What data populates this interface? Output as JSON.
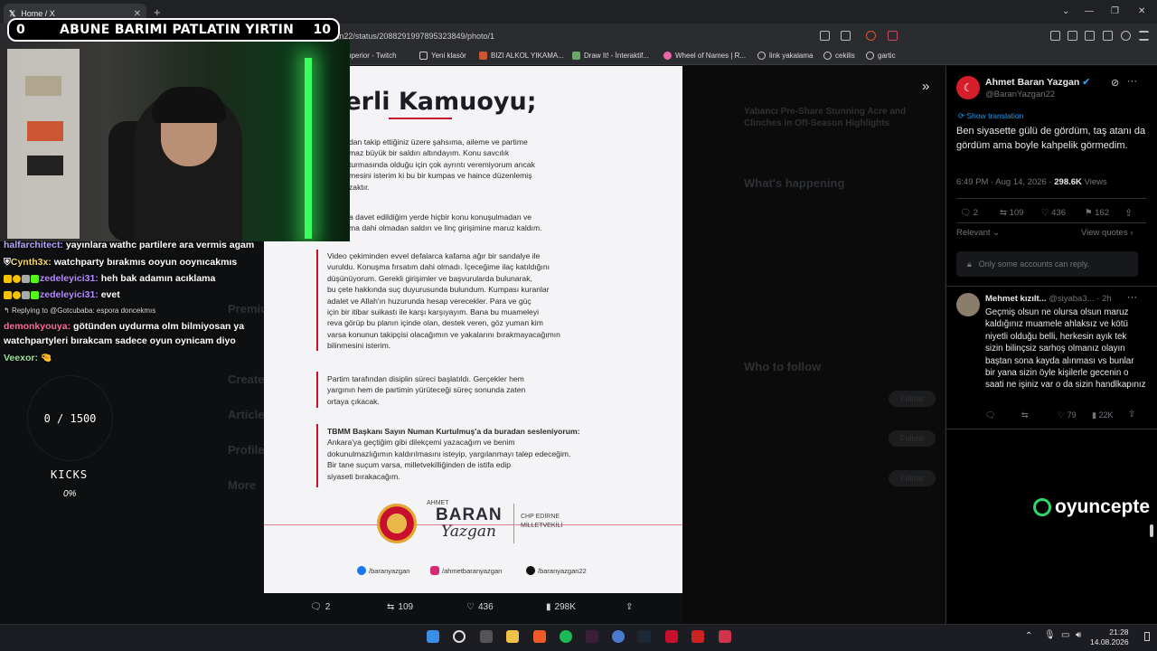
{
  "browser": {
    "tab_title": "Home / X",
    "new_tab": "+",
    "url": "x.com/BaranYazgan22/status/2088291997895323849/photo/1",
    "bookmarks": [
      "superior - Twitch",
      "Yeni klasör",
      "BIZI ALKOL YIKAMA...",
      "Draw It! - İnteraktif...",
      "Wheel of Names | R...",
      "link yakalama",
      "cekilis",
      "gartic"
    ]
  },
  "stream": {
    "left_score": "0",
    "title": "ABUNE BARIMI PATLATIN YIRTIN",
    "right_score": "10",
    "goal": "0 / 1500",
    "kicks_label": "KICKS",
    "kicks_pct": "0%",
    "sponsor": "oyuncepte",
    "chat": [
      {
        "user": "halfarchitect:",
        "text": " yayınlara wathc partilere ara vermis agam"
      },
      {
        "user": "Cynth3x:",
        "text": " watchparty bırakmıs ooyun ooynıcakmıs"
      },
      {
        "user": "zedeleyici31:",
        "text": " heh bak adamın acıklama"
      },
      {
        "user": "zedeleyici31:",
        "text": " evet"
      },
      {
        "reply": "Replying to @Gotcubaba: espora doncekmıs"
      },
      {
        "user": "demonkyouya:",
        "text": " götünden uydurma olm bilmiyosan ya"
      },
      {
        "cont": "watchpartyleri bırakcam sadece oyun oynicam diyo"
      },
      {
        "user": "Veexor:",
        "text": " 🤏"
      }
    ]
  },
  "photo": {
    "headline": "ğerli Kamuoyu;",
    "p1": [
      "dan takip ettiğiniz üzere şahsıma, aileme ve partime",
      "maz büyük bir saldırı altındayım. Konu savcılık",
      "turmasında olduğu için çok ayrıntı veremiyorum ancak",
      "mesini isterim ki bu bir kumpas ve haince düzenlemiş",
      "zaktır."
    ],
    "p2": [
      "a davet edildiğim yerde hiçbir konu konuşulmadan ve",
      "ma dahi olmadan saldırı ve linç girişimine maruz kaldım."
    ],
    "p3": [
      "Video çekiminden evvel defalarca kafama ağır bir sandalye ile",
      "vuruldu. Konuşma fırsatım dahi olmadı. İçeceğime ilaç katıldığını",
      "düşünüyorum. Gerekli girişimler ve başvurularda bulunarak,",
      "bu çete hakkında suç duyurusunda bulundum. Kumpası kuranlar",
      "adalet ve Allah'ın huzurunda hesap verecekler. Para ve güç",
      "için bir itibar suikastı ile karşı karşıyayım. Bana bu muameleyi",
      "reva görüp bu planın içinde olan, destek veren, göz yuman kim",
      "varsa konunun takipçisi olacağımın ve yakalarını bırakmayacağımın",
      "bilinmesini isterim."
    ],
    "p4": [
      "Partim tarafından disiplin süreci başlatıldı. Gerçekler hem",
      "yargının hem de partimin yürüteceği süreç sonunda zaten",
      "ortaya çıkacak."
    ],
    "p5_title": "TBMM Başkanı Sayın Numan Kurtulmuş'a da buradan sesleniyorum:",
    "p5": [
      "Ankara'ya geçtiğim gibi dilekçemi yazacağım ve benim",
      "dokunulmazlığımın kaldırılmasını isteyip, yargılanmayı talep edeceğim.",
      "Bir tane suçum varsa, milletvekilliğinden de istifa edip",
      "siyaseti bırakacağım."
    ],
    "sig_small": "AHMET",
    "sig_big": "BARAN",
    "sig_script": "Yazgan",
    "org": [
      "CHP EDİRNE",
      "MİLLETVEKİLİ"
    ],
    "social": [
      "/baranyazgan",
      "/ahmetbaranyazgan",
      "/baranyazgan22"
    ]
  },
  "photo_actions": {
    "replies": "2",
    "reposts": "109",
    "likes": "436",
    "views": "298K"
  },
  "tweet": {
    "name": "Ahmet Baran Yazgan",
    "handle": "@BaranYazgan22",
    "show_translation": "Show translation",
    "text": "Ben siyasette gülü de gördüm, taş atanı da gördüm ama boyle kahpelik görmedim.",
    "time": "6:49 PM · Aug 14, 2026 · ",
    "views_count": "298.6K",
    "views_label": " Views",
    "replies": "2",
    "reposts": "109",
    "likes": "436",
    "bookmarks": "162",
    "relevant": "Relevant",
    "view_quotes": "View quotes",
    "reply_restricted": "Only some accounts can reply."
  },
  "reply": {
    "name": "Mehmet kızılt...",
    "handle": "@siyaba3...",
    "age": "· 2h",
    "text": "Geçmiş olsun ne olursa olsun maruz kaldığınız muamele ahlaksız ve kötü niyetli olduğu belli, herkesin ayık tek sizin bilinçsiz sarhoş olmanız olayın baştan sona kayda alınması vs bunlar bir yana sizin öyle kişilerle gecenin o saati ne işiniz var o da sizin    handlkapınız",
    "likes": "79",
    "views": "22K"
  },
  "background": {
    "trending": [
      "Yabancı Pre-Share Stunning Acre and",
      "Clinches in Off-Season Highlights"
    ],
    "whats_happening": "What's happening",
    "who_to_follow": "Who to follow",
    "follow": "Follow",
    "nav": [
      "Premium",
      "Create",
      "Articles",
      "Profile",
      "More"
    ]
  },
  "clock": {
    "time": "21:28",
    "date": "14.08.2026"
  },
  "colors": {
    "accent": "#1d9bf0",
    "brand_red": "#c8102e",
    "neon": "#3bff5e"
  }
}
